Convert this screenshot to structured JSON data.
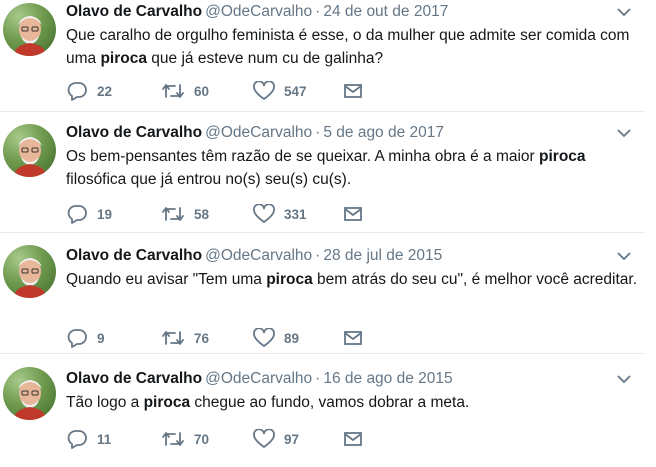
{
  "tweets": [
    {
      "name": "Olavo de Carvalho",
      "handle": "@OdeCarvalho",
      "separator": "·",
      "date": "24 de out de 2017",
      "text_before": "Que caralho de orgulho feminista é esse, o da mulher que admite ser comida com uma ",
      "highlight": "piroca",
      "text_after": " que já esteve num cu de galinha?",
      "replies": "22",
      "retweets": "60",
      "likes": "547"
    },
    {
      "name": "Olavo de Carvalho",
      "handle": "@OdeCarvalho",
      "separator": "·",
      "date": "5 de ago de 2017",
      "text_before": "Os bem-pensantes têm razão de se queixar. A minha obra é a maior ",
      "highlight": "piroca",
      "text_after": " filosófica que já entrou no(s) seu(s) cu(s).",
      "replies": "19",
      "retweets": "58",
      "likes": "331"
    },
    {
      "name": "Olavo de Carvalho",
      "handle": "@OdeCarvalho",
      "separator": "·",
      "date": "28 de jul de 2015",
      "text_before": "Quando eu avisar \"Tem uma ",
      "highlight": "piroca",
      "text_after": " bem atrás do seu cu\", é melhor você acreditar.",
      "replies": "9",
      "retweets": "76",
      "likes": "89"
    },
    {
      "name": "Olavo de Carvalho",
      "handle": "@OdeCarvalho",
      "separator": "·",
      "date": "16 de ago de 2015",
      "text_before": "Tão logo a ",
      "highlight": "piroca",
      "text_after": " chegue ao fundo, vamos dobrar a meta.",
      "replies": "11",
      "retweets": "70",
      "likes": "97"
    }
  ],
  "icons": {
    "reply": "reply-icon",
    "retweet": "retweet-icon",
    "like": "heart-icon",
    "message": "envelope-icon",
    "menu": "chevron-down-icon"
  },
  "colors": {
    "icon_gray": "#657786",
    "text": "#14171a",
    "divider": "#e6ecf0"
  }
}
